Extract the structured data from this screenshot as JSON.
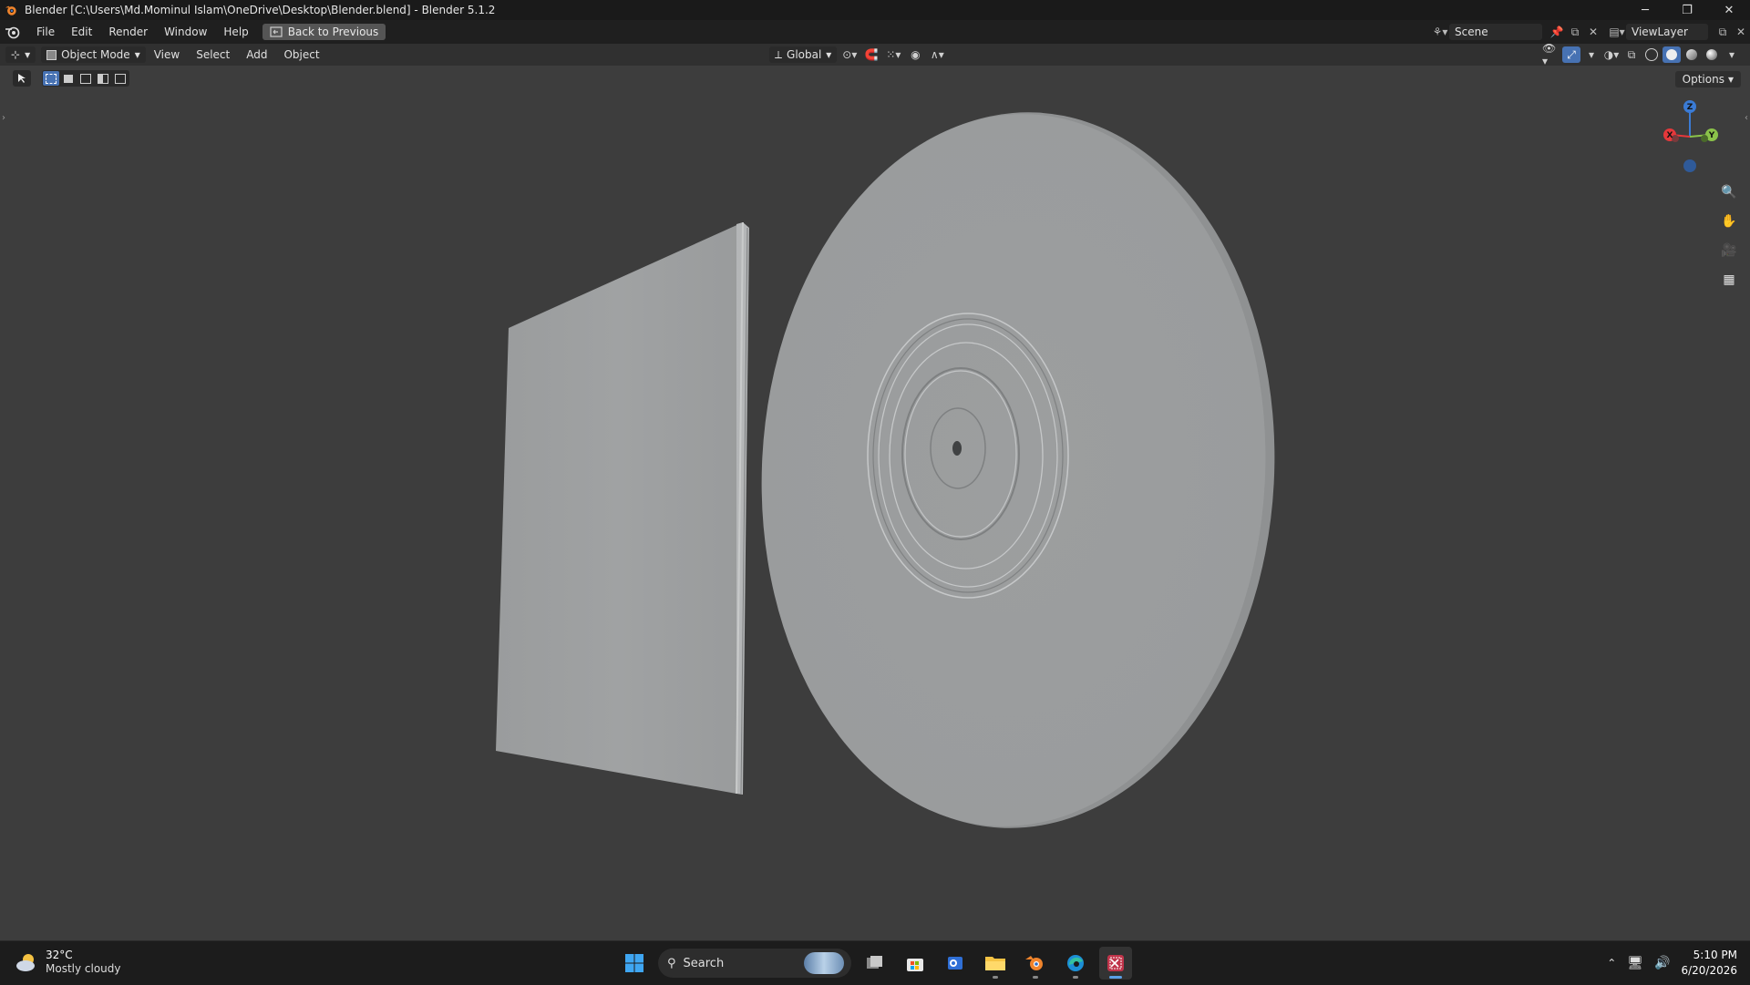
{
  "window": {
    "title": "Blender [C:\\Users\\Md.Mominul Islam\\OneDrive\\Desktop\\Blender.blend] - Blender 5.1.2",
    "controls": {
      "minimize": "─",
      "restore": "❐",
      "close": "✕"
    }
  },
  "menubar": {
    "items": [
      "File",
      "Edit",
      "Render",
      "Window",
      "Help"
    ],
    "back_button": "Back to Previous",
    "scene": "Scene",
    "view_layer": "ViewLayer"
  },
  "viewport_header": {
    "mode": "Object Mode",
    "menus": [
      "View",
      "Select",
      "Add",
      "Object"
    ],
    "orientation": "Global",
    "options": "Options"
  },
  "gizmo": {
    "z": "Z",
    "y": "Y",
    "x": "X"
  },
  "taskbar": {
    "weather_temp": "32°C",
    "weather_condition": "Mostly cloudy",
    "search_placeholder": "Search",
    "time": "5:10 PM",
    "date": "6/20/2026"
  },
  "colors": {
    "accent": "#4772b3",
    "axis_x": "#e5383b",
    "axis_y": "#8bc34a",
    "axis_z": "#3a7bd5",
    "object_gray": "#9b9d9e",
    "viewport_bg": "#3d3d3d"
  }
}
